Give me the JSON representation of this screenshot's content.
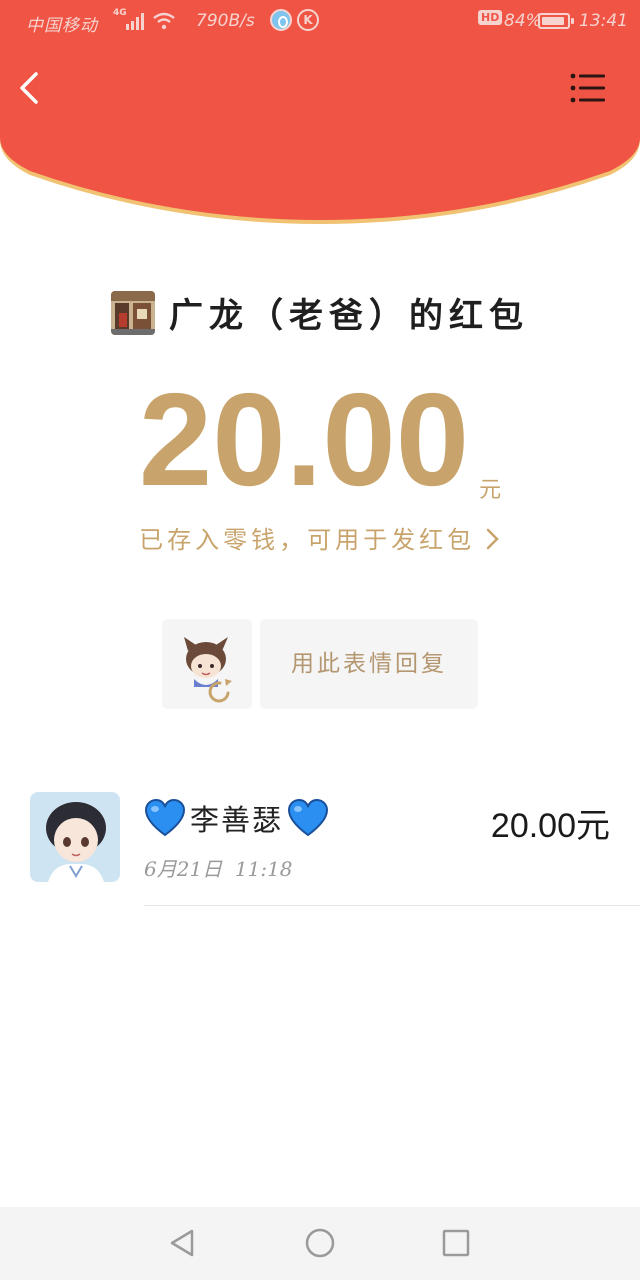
{
  "status_bar": {
    "carrier": "中国移动",
    "network": "4G",
    "speed": "790B/s",
    "app_icon_2": "K",
    "hd_badge": "HD",
    "battery": "84%",
    "time": "13:41"
  },
  "header": {
    "color": "#f05444",
    "back_icon": "chevron-left-icon",
    "menu_icon": "list-menu-icon"
  },
  "red_packet": {
    "title": "广龙（老爸）的红包",
    "amount": "20.00",
    "unit": "元",
    "saved_note": "已存入零钱，可用于发红包",
    "saved_note_chevron": "›",
    "accent_color": "#c8a46c"
  },
  "reply": {
    "sticker_icon": "sticker-avatar-icon",
    "label": "用此表情回复"
  },
  "receivers": [
    {
      "name": "李善瑟",
      "emoji": "blue-heart",
      "time": "6月21日  11:18",
      "amount": "20.00元"
    }
  ],
  "nav_bar": {
    "back_icon": "triangle-back-icon",
    "home_icon": "circle-home-icon",
    "recents_icon": "square-recents-icon"
  }
}
